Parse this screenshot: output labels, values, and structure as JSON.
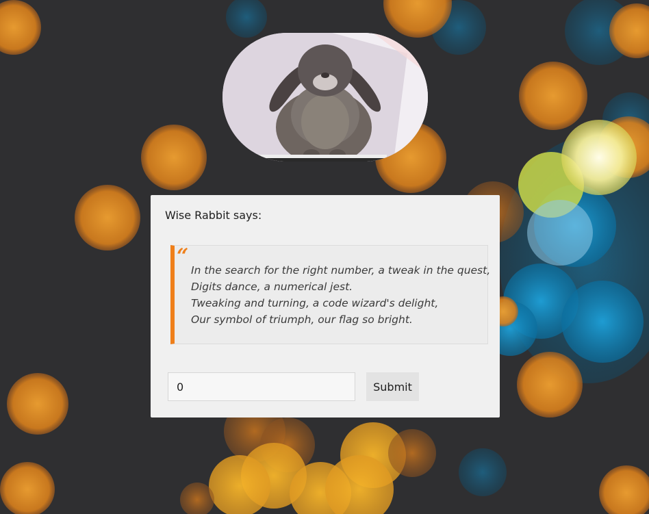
{
  "card": {
    "title": "Wise Rabbit says:",
    "quote_mark": "“",
    "quote_lines": [
      "In the search for the right number, a tweak in the quest,",
      "Digits dance, a numerical jest.",
      "Tweaking and turning, a code wizard's delight,",
      "Our symbol of triumph, our flag so bright."
    ],
    "input_value": "0",
    "submit_label": "Submit"
  },
  "avatar": {
    "subject": "rabbit-photo"
  },
  "colors": {
    "accent": "#ef7f1a",
    "background": "#2f2f31",
    "card": "#f0f0f0"
  }
}
